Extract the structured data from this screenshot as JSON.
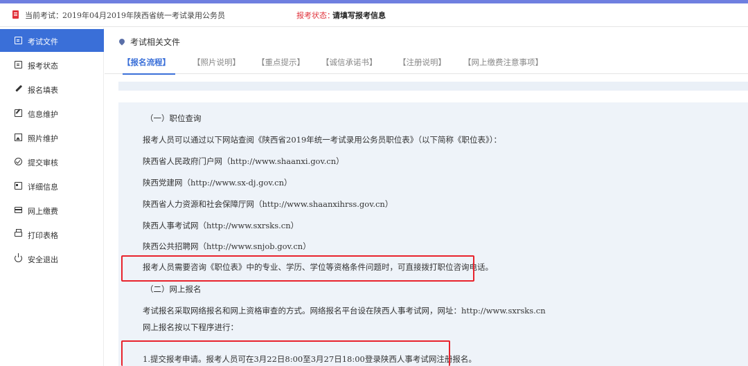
{
  "topbar": {
    "exam_label": "当前考试：",
    "exam_name": "2019年04月2019年陕西省统一考试录用公务员",
    "status_label": "报考状态：",
    "status_value": "请填写报考信息",
    "icon": "document-icon"
  },
  "sidebar": {
    "items": [
      {
        "label": "考试文件",
        "icon": "file-icon"
      },
      {
        "label": "报考状态",
        "icon": "file-icon"
      },
      {
        "label": "报名填表",
        "icon": "pencil-icon"
      },
      {
        "label": "信息维护",
        "icon": "edit-icon"
      },
      {
        "label": "照片维护",
        "icon": "photo-icon"
      },
      {
        "label": "提交审核",
        "icon": "check-circle-icon"
      },
      {
        "label": "详细信息",
        "icon": "id-card-icon"
      },
      {
        "label": "网上缴费",
        "icon": "credit-card-icon"
      },
      {
        "label": "打印表格",
        "icon": "printer-icon"
      },
      {
        "label": "安全退出",
        "icon": "power-icon"
      }
    ],
    "active_index": 0
  },
  "main": {
    "breadcrumb": "考试相关文件",
    "tabs": [
      {
        "label": "【报名流程】"
      },
      {
        "label": "【照片说明】"
      },
      {
        "label": "【重点提示】"
      },
      {
        "label": "【诚信承诺书】"
      },
      {
        "label": "【注册说明】"
      },
      {
        "label": "【网上缴费注意事项】"
      }
    ],
    "content": {
      "section1_title": "（一）职位查询",
      "section1_intro": "报考人员可以通过以下网站查阅《陕西省2019年统一考试录用公务员职位表》（以下简称《职位表》）：",
      "sites": [
        "陕西省人民政府门户网（http://www.shaanxi.gov.cn）",
        "陕西党建网（http://www.sx-dj.gov.cn）",
        "陕西省人力资源和社会保障厅网（http://www.shaanxihrss.gov.cn）",
        "陕西人事考试网（http://www.sxrsks.cn）",
        "陕西公共招聘网（http://www.snjob.gov.cn）"
      ],
      "consult_note": "报考人员需要咨询《职位表》中的专业、学历、学位等资格条件问题时，可直接拨打职位咨询电话。",
      "section2_title": "（二）网上报名",
      "section2_intro": "考试报名采取网络报名和网上资格审查的方式。网络报名平台设在陕西人事考试网，网址：http://www.sxrsks.cn",
      "section2_steps_intro": "网上报名按以下程序进行：",
      "step1": "1.提交报考申请。报考人员可在3月22日8:00至3月27日18:00登录陕西人事考试网注册报名。"
    }
  },
  "colors": {
    "accent": "#3a6fd8",
    "status_red": "#e0313a",
    "highlight_border": "#e8222c",
    "panel_bg": "#eef3f9"
  }
}
